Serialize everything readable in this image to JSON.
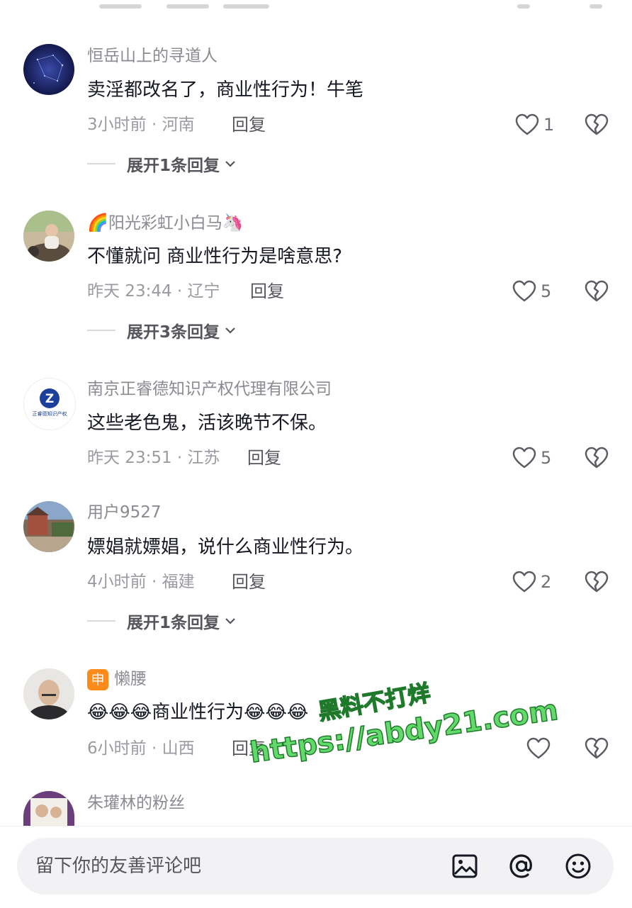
{
  "comments": [
    {
      "author": "恒岳山上的寻道人",
      "text": "卖淫都改名了，商业性行为！牛笔",
      "time": "3小时前",
      "location": "河南",
      "reply_label": "回复",
      "likes": "1",
      "expand": "展开1条回复"
    },
    {
      "author_prefix_emoji": "🌈",
      "author": "阳光彩虹小白马",
      "author_suffix_emoji": "🦄",
      "text": "不懂就问 商业性行为是啥意思?",
      "time": "昨天 23:44",
      "location": "辽宁",
      "reply_label": "回复",
      "likes": "5",
      "expand": "展开3条回复"
    },
    {
      "author": "南京正睿德知识产权代理有限公司",
      "avatar_text": "正睿德知识产权",
      "text": "这些老色鬼，活该晚节不保。",
      "time": "昨天 23:51",
      "location": "江苏",
      "reply_label": "回复",
      "likes": "5"
    },
    {
      "author": "用户9527",
      "text": "嫖娼就嫖娼，说什么商业性行为。",
      "time": "4小时前",
      "location": "福建",
      "reply_label": "回复",
      "likes": "2",
      "expand": "展开1条回复"
    },
    {
      "author_badge": "申",
      "author": "懒腰",
      "text_prefix": "😂😂😂",
      "text": "商业性行为",
      "text_suffix": "😂😂😂",
      "time": "6小时前",
      "location": "山西",
      "reply_label": "回复",
      "likes": ""
    },
    {
      "author": "朱瓘林的粉丝"
    }
  ],
  "input": {
    "placeholder": "留下你的友善评论吧"
  },
  "icons": {
    "like": "heart-outline-icon",
    "dislike": "broken-heart-icon",
    "expand": "chevron-down-icon",
    "image": "image-icon",
    "mention": "at-icon",
    "emoji": "smiley-icon"
  },
  "watermark": {
    "line1": "黑料不打烊",
    "line2": "https://abdy21.com"
  }
}
